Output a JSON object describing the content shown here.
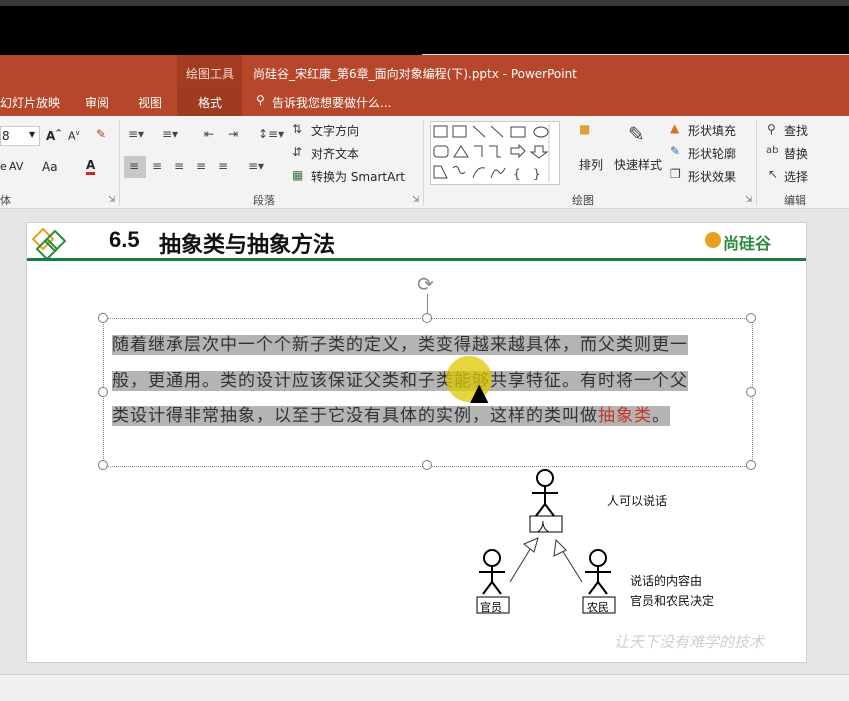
{
  "window": {
    "context_group": "绘图工具",
    "title": "尚硅谷_宋红康_第6章_面向对象编程(下).pptx - PowerPoint"
  },
  "tabs": [
    {
      "label": "幻灯片放映"
    },
    {
      "label": "审阅"
    },
    {
      "label": "视图"
    },
    {
      "label": "格式"
    }
  ],
  "tell_me": "告诉我您想要做什么...",
  "ribbon": {
    "font_size": "8",
    "font_group_label": "体",
    "paragraph_group_label": "段落",
    "drawing_group_label": "绘图",
    "editing_group_label": "编辑",
    "text_direction": "文字方向",
    "align_text": "对齐文本",
    "convert_smartart": "转换为 SmartArt",
    "arrange": "排列",
    "quick_styles": "快速样式",
    "shape_fill": "形状填充",
    "shape_outline": "形状轮廓",
    "shape_effects": "形状效果",
    "find": "查找",
    "replace": "替换",
    "select": "选择",
    "aa_label": "Aa",
    "av_label": "AV"
  },
  "slide": {
    "number": "6.5",
    "heading": "抽象类与抽象方法",
    "logo_text": "尚硅谷",
    "body_line1": "随着继承层次中一个个新子类的定义，类变得越来越具体，而父类则更一",
    "body_line2": "般，更通用。类的设计应该保证父类和子类能够共享特征。有时将一个父",
    "body_line3_a": "类设计得非常抽象，以至于它没有具体的实例，这样的类叫做",
    "body_line3_b": "抽象类",
    "body_line3_c": "。",
    "diagram": {
      "person": "人",
      "official": "官员",
      "farmer": "农民",
      "note1": "人可以说话",
      "note2_line1": "说话的内容由",
      "note2_line2": "官员和农民决定"
    },
    "watermark": "让天下没有难学的技术"
  },
  "colors": {
    "accent": "#b7472a",
    "highlight_red": "#c0392b",
    "slide_rule": "#1a7a4c",
    "logo_green": "#2e8b3e"
  }
}
